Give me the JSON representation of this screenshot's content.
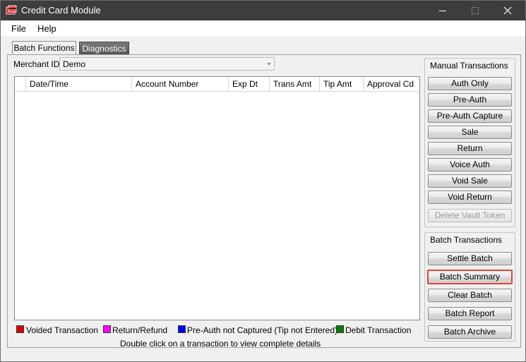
{
  "window": {
    "title": "Credit Card Module"
  },
  "menu": {
    "file": "File",
    "help": "Help"
  },
  "tabs": [
    {
      "label": "Batch Functions"
    },
    {
      "label": "Diagnostics"
    }
  ],
  "merchant": {
    "label": "Merchant ID",
    "value": "Demo"
  },
  "grid": {
    "columns": [
      "",
      "Date/Time",
      "Account Number",
      "Exp Dt",
      "Trans Amt",
      "Tip Amt",
      "Approval Cd"
    ]
  },
  "manual": {
    "title": "Manual Transactions",
    "buttons": [
      "Auth Only",
      "Pre-Auth",
      "Pre-Auth Capture",
      "Sale",
      "Return",
      "Voice Auth",
      "Void Sale",
      "Void Return",
      "Delete Vault Token"
    ]
  },
  "batch": {
    "title": "Batch Transactions",
    "buttons": [
      "Settle Batch",
      "Batch Summary",
      "Clear Batch",
      "Batch Report",
      "Batch Archive"
    ]
  },
  "legend": [
    {
      "label": "Voided Transaction",
      "color": "#e00000"
    },
    {
      "label": "Return/Refund",
      "color": "#ff00ff"
    },
    {
      "label": "Pre-Auth not Captured (Tip not Entered)",
      "color": "#0000ff"
    },
    {
      "label": "Debit Transaction",
      "color": "#008000"
    }
  ],
  "hint": "Double click on a transaction to view complete details"
}
